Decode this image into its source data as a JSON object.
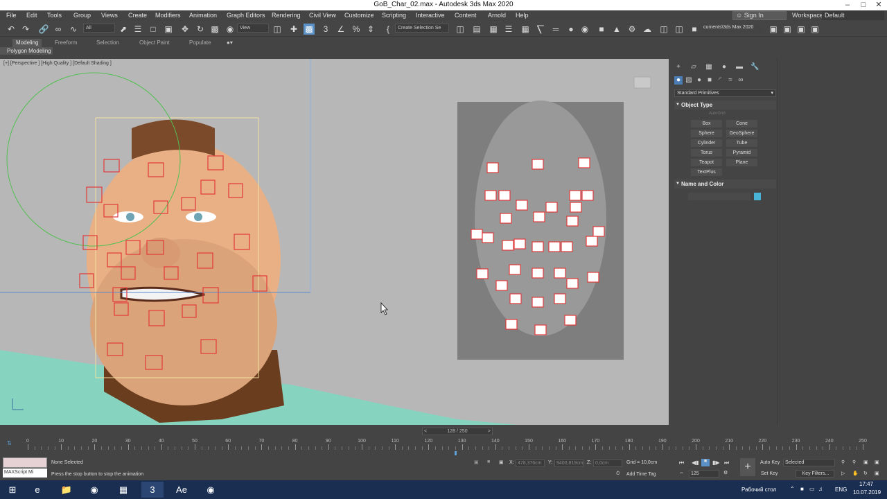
{
  "window": {
    "title": "GoB_Char_02.max - Autodesk 3ds Max 2020"
  },
  "menu": [
    "File",
    "Edit",
    "Tools",
    "Group",
    "Views",
    "Create",
    "Modifiers",
    "Animation",
    "Graph Editors",
    "Rendering",
    "Civil View",
    "Customize",
    "Scripting",
    "Interactive",
    "Content",
    "Arnold",
    "Help"
  ],
  "account": {
    "signin": "Sign In",
    "workspaces_label": "Workspaces:",
    "workspace": "Default"
  },
  "toolbar": {
    "filter": "All",
    "view": "View",
    "selection_set": "Create Selection Se",
    "project_path": "cuments\\3ds Max 2020"
  },
  "ribbon": {
    "tabs": [
      "Modeling",
      "Freeform",
      "Selection",
      "Object Paint",
      "Populate"
    ],
    "active_tab": "Modeling",
    "panel": "Polygon Modeling"
  },
  "viewport": {
    "label": "[+] [Perspective ] [High Quality ] [Default Shading ]"
  },
  "command_panel": {
    "category": "Standard Primitives",
    "object_type_title": "Object Type",
    "autogrid": "AutoGrid",
    "buttons": [
      "Box",
      "Cone",
      "Sphere",
      "GeoSphere",
      "Cylinder",
      "Tube",
      "Torus",
      "Pyramid",
      "Teapot",
      "Plane",
      "TextPlus"
    ],
    "name_color_title": "Name and Color",
    "swatch_color": "#4ab4d6"
  },
  "timeline": {
    "frame_display": "128 / 250",
    "current_frame": 128,
    "total_frames": 250,
    "labels": [
      "0",
      "10",
      "20",
      "30",
      "40",
      "50",
      "60",
      "70",
      "80",
      "90",
      "100",
      "110",
      "120",
      "130",
      "140",
      "150",
      "160",
      "170",
      "180",
      "190",
      "200",
      "210",
      "220",
      "230",
      "240",
      "250"
    ]
  },
  "status": {
    "maxscript": "MAXScript Mi",
    "selection": "None Selected",
    "prompt": "Press the stop button to stop the animation",
    "x_label": "X:",
    "x_value": "478,376cm",
    "y_label": "Y:",
    "y_value": "9400,819cm",
    "z_label": "Z:",
    "z_value": "0,0cm",
    "grid": "Grid = 10,0cm",
    "add_time_tag": "Add Time Tag",
    "frame_field": "125",
    "auto_key": "Auto Key",
    "selected": "Selected",
    "set_key": "Set Key",
    "key_filters": "Key Filters..."
  },
  "taskbar": {
    "desktop": "Рабочий стол",
    "lang": "ENG",
    "time": "17:47",
    "date": "10.07.2019"
  }
}
